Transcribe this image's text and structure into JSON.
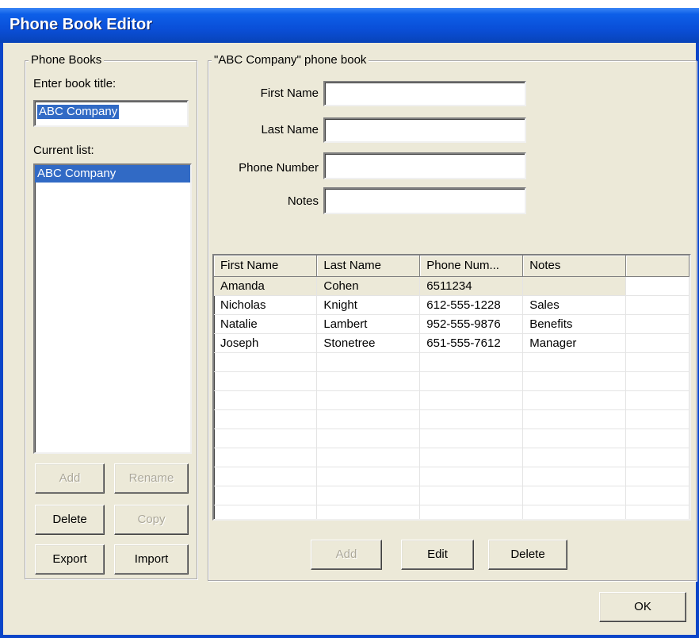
{
  "window": {
    "title": "Phone Book Editor"
  },
  "phone_books": {
    "group_label": "Phone Books",
    "title_label": "Enter book title:",
    "title_value": "ABC Company",
    "list_label": "Current list:",
    "items": [
      {
        "label": "ABC Company",
        "selected": true
      }
    ],
    "buttons": {
      "add": "Add",
      "rename": "Rename",
      "delete": "Delete",
      "copy": "Copy",
      "export": "Export",
      "import": "Import"
    }
  },
  "book": {
    "group_label": "\"ABC Company\" phone book",
    "fields": {
      "first_name_label": "First Name",
      "first_name_value": "",
      "last_name_label": "Last Name",
      "last_name_value": "",
      "phone_label": "Phone Number",
      "phone_value": "",
      "notes_label": "Notes",
      "notes_value": ""
    },
    "table": {
      "columns": [
        "First Name",
        "Last Name",
        "Phone Num...",
        "Notes",
        ""
      ],
      "rows": [
        [
          "Amanda",
          "Cohen",
          "6511234",
          ""
        ],
        [
          "Nicholas",
          "Knight",
          "612-555-1228",
          "Sales"
        ],
        [
          "Natalie",
          "Lambert",
          "952-555-9876",
          "Benefits"
        ],
        [
          "Joseph",
          "Stonetree",
          "651-555-7612",
          "Manager"
        ]
      ]
    },
    "buttons": {
      "add": "Add",
      "edit": "Edit",
      "delete": "Delete"
    }
  },
  "ok_button": "OK"
}
